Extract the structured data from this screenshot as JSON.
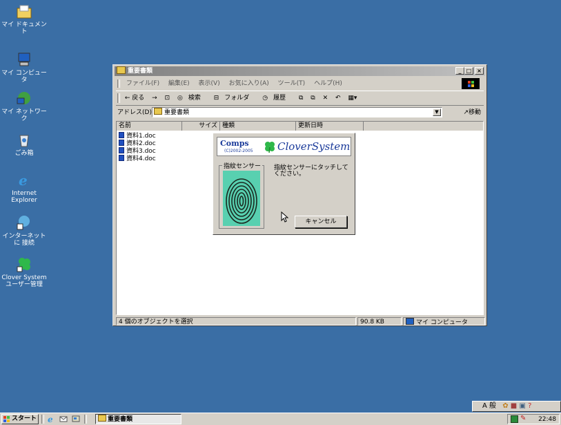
{
  "desktop": {
    "icons": [
      {
        "label": "マイ ドキュメント"
      },
      {
        "label": "マイ コンピュータ"
      },
      {
        "label": "マイ ネットワーク"
      },
      {
        "label": "ごみ箱"
      },
      {
        "label": "Internet Explorer"
      },
      {
        "label": "インターネットに 接続"
      },
      {
        "label": "Clover System ユーザー管理"
      }
    ]
  },
  "window": {
    "title": "重要書類",
    "menu": [
      "ファイル(F)",
      "編集(E)",
      "表示(V)",
      "お気に入り(A)",
      "ツール(T)",
      "ヘルプ(H)"
    ],
    "toolbar": {
      "back": "← 戻る",
      "forward": "→",
      "search": "検索",
      "folders": "フォルダ",
      "history": "履歴"
    },
    "address": {
      "label": "アドレス(D)",
      "value": "重要書類",
      "go": "移動"
    },
    "columns": [
      "名前",
      "サイズ",
      "種類",
      "更新日時"
    ],
    "files": [
      "資料1.doc",
      "資料2.doc",
      "資料3.doc",
      "資料4.doc"
    ],
    "status": {
      "selection": "4 個のオブジェクトを選択",
      "size": "90.8 KB",
      "location": "マイ コンピュータ"
    }
  },
  "dialog": {
    "brand_small": "Comps",
    "copyright": "(C)2002-2005",
    "brand": "CloverSystem",
    "group_label": "指紋センサー",
    "instruction": "指紋センサーにタッチして ください。",
    "cancel": "キャンセル"
  },
  "taskbar": {
    "start": "スタート",
    "task": "重要書類",
    "ime": "A 般",
    "clock": "22:48"
  },
  "colors": {
    "desktop": "#3a6ea5",
    "accent": "#1a3a9a",
    "clover": "#2fb84a"
  }
}
